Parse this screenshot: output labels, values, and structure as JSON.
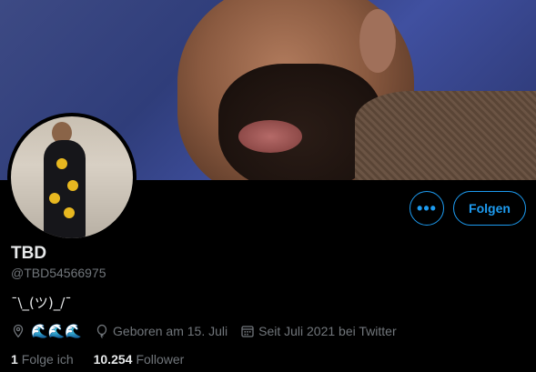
{
  "profile": {
    "name": "TBD",
    "handle": "@TBD54566975",
    "bio": "¯\\_(ツ)_/¯",
    "location": "🌊🌊🌊",
    "birthday": "Geboren am 15. Juli",
    "joined": "Seit Juli 2021 bei Twitter"
  },
  "actions": {
    "more_label": "•••",
    "follow_label": "Folgen"
  },
  "stats": {
    "following_count": "1",
    "following_label": "Folge ich",
    "followers_count": "10.254",
    "followers_label": "Follower"
  },
  "colors": {
    "accent": "#1d9bf0",
    "background": "#000000",
    "secondary_text": "#71767b"
  },
  "icons": [
    "location-icon",
    "birthday-icon",
    "calendar-icon"
  ]
}
